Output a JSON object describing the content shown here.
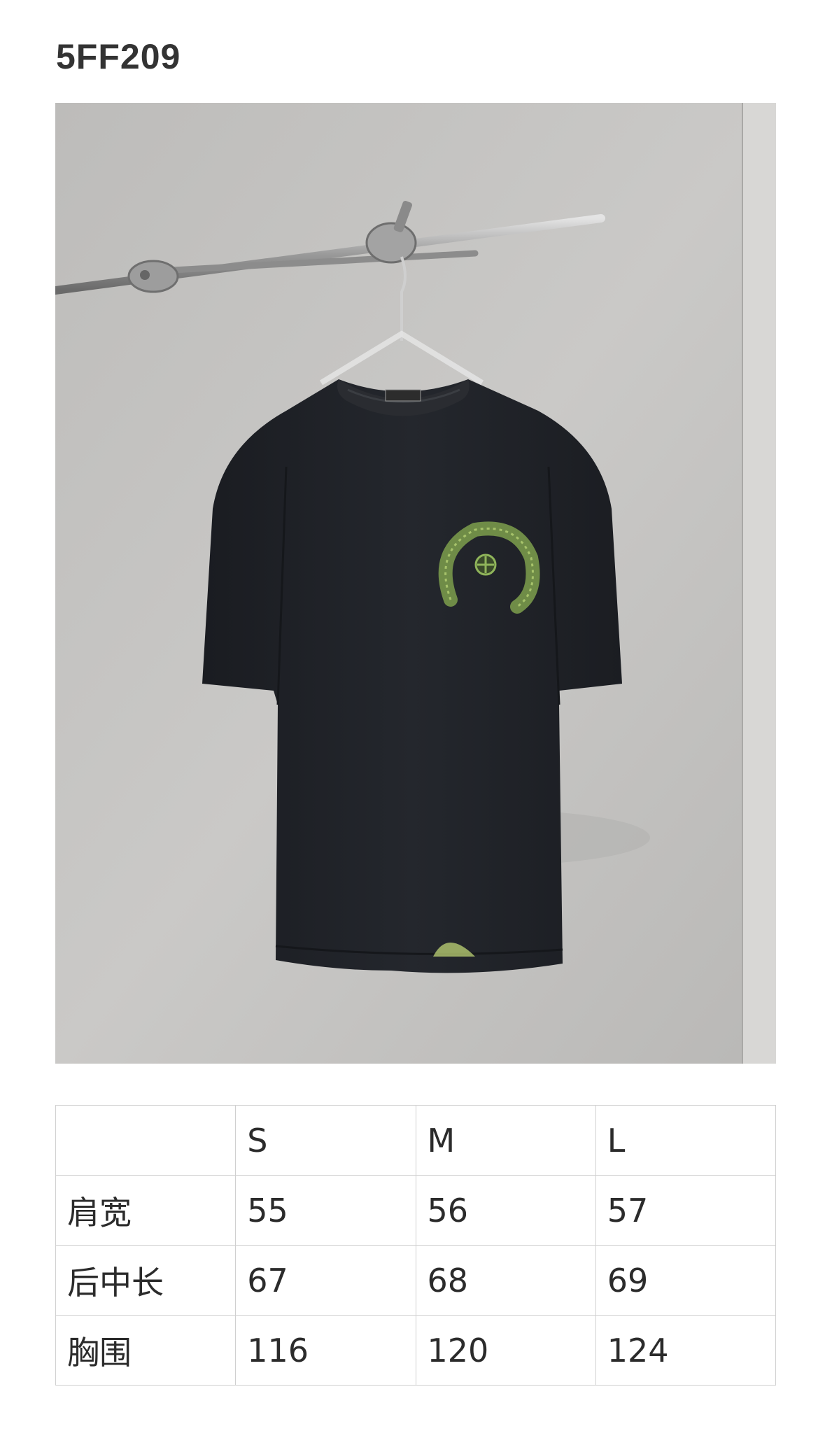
{
  "product": {
    "code": "5FF209",
    "image_alt": "black t-shirt on hanger",
    "logo_icon": "horseshoe-cross-logo-icon"
  },
  "size_table": {
    "header": [
      "",
      "S",
      "M",
      "L"
    ],
    "rows": [
      {
        "label": "肩宽",
        "values": [
          "55",
          "56",
          "57"
        ]
      },
      {
        "label": "后中长",
        "values": [
          "67",
          "68",
          "69"
        ]
      },
      {
        "label": "胸围",
        "values": [
          "116",
          "120",
          "124"
        ]
      }
    ]
  },
  "colors": {
    "background": "#ffffff",
    "photo_backdrop": "#c4c3c1",
    "shirt": "#1f2126",
    "logo_green": "#8fb45a",
    "table_border": "#d0d0d0",
    "text": "#2b2b2b"
  }
}
